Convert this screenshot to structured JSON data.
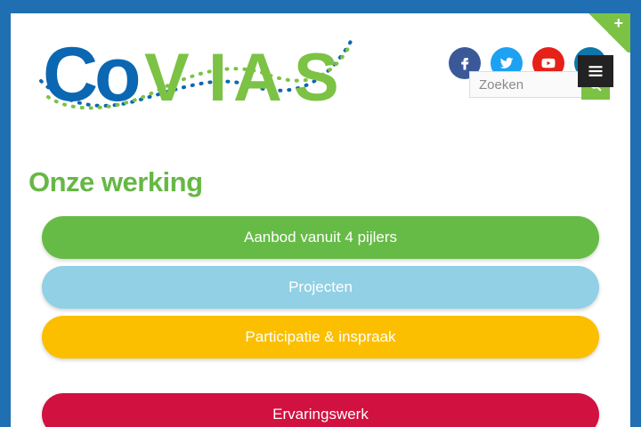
{
  "header": {
    "logo_text": "CoVIAS",
    "social": [
      {
        "name": "facebook",
        "icon": "facebook-icon",
        "color": "#3b5998"
      },
      {
        "name": "twitter",
        "icon": "twitter-icon",
        "color": "#1da1f2"
      },
      {
        "name": "youtube",
        "icon": "youtube-icon",
        "color": "#e62117"
      },
      {
        "name": "linkedin",
        "icon": "linkedin-icon",
        "color": "#0e76a8"
      }
    ],
    "search": {
      "placeholder": "Zoeken"
    },
    "menu_icon": "hamburger-icon"
  },
  "main": {
    "title": "Onze werking",
    "buttons": [
      {
        "label": "Aanbod vanuit 4 pijlers",
        "color": "#65bb46"
      },
      {
        "label": "Projecten",
        "color": "#91d0e5"
      },
      {
        "label": "Participatie & inspraak",
        "color": "#fbbf00"
      },
      {
        "label": "Ervaringswerk",
        "color": "#d11140"
      }
    ]
  },
  "colors": {
    "background": "#1f6fb2",
    "accent_green": "#7cc245",
    "logo_blue": "#0b67b2",
    "logo_green": "#7cc245"
  }
}
